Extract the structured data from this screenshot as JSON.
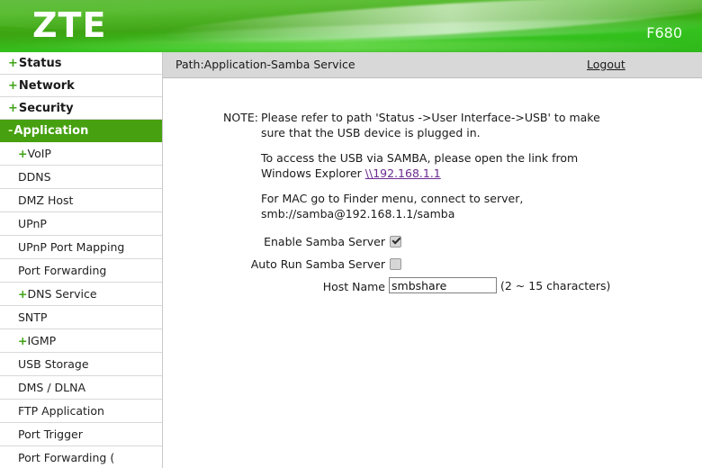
{
  "banner": {
    "logo": "ZTE",
    "model": "F680",
    "brand_green": "#3fae16"
  },
  "sidebar": {
    "top_items": [
      {
        "prefix": "+",
        "label": "Status",
        "active": false
      },
      {
        "prefix": "+",
        "label": "Network",
        "active": false
      },
      {
        "prefix": "+",
        "label": "Security",
        "active": false
      },
      {
        "prefix": "-",
        "label": "Application",
        "active": true
      }
    ],
    "sub_items": [
      {
        "prefix": "+",
        "label": "VoIP"
      },
      {
        "prefix": "",
        "label": "DDNS"
      },
      {
        "prefix": "",
        "label": "DMZ Host"
      },
      {
        "prefix": "",
        "label": "UPnP"
      },
      {
        "prefix": "",
        "label": "UPnP Port Mapping"
      },
      {
        "prefix": "",
        "label": "Port Forwarding"
      },
      {
        "prefix": "+",
        "label": "DNS Service"
      },
      {
        "prefix": "",
        "label": "SNTP"
      },
      {
        "prefix": "+",
        "label": "IGMP"
      },
      {
        "prefix": "",
        "label": "USB Storage"
      },
      {
        "prefix": "",
        "label": "DMS / DLNA"
      },
      {
        "prefix": "",
        "label": "FTP Application"
      },
      {
        "prefix": "",
        "label": "Port Trigger"
      },
      {
        "prefix": "",
        "label": "Port Forwarding ("
      }
    ],
    "active_bg": "#46a010"
  },
  "pathbar": {
    "path": "Path:Application-Samba Service",
    "logout": "Logout"
  },
  "note": {
    "label": "NOTE:",
    "line1": "Please refer to path 'Status ->User Interface->USB' to make",
    "line2": "sure that the USB device is plugged in.",
    "para2_line1": "To access the USB via SAMBA, please open the link from",
    "para2_line2_prefix": "Windows Explorer ",
    "para2_link": "\\\\192.168.1.1",
    "para3_line1": "For MAC go to Finder menu, connect to server,",
    "para3_line2": "smb://samba@192.168.1.1/samba",
    "link_color": "#6b2a8f"
  },
  "form": {
    "enable_samba_label": "Enable Samba Server",
    "enable_samba_checked": true,
    "auto_run_label": "Auto Run Samba Server",
    "auto_run_checked": false,
    "host_name_label": "Host Name",
    "host_name_value": "smbshare",
    "host_name_hint": "(2 ~ 15 characters)"
  }
}
